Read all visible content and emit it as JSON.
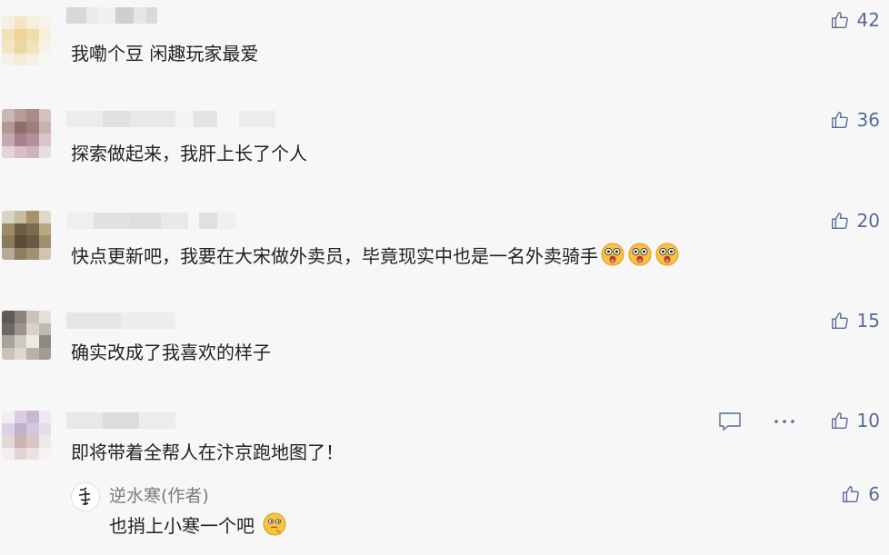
{
  "comments": [
    {
      "text": "我嘞个豆 闲趣玩家最爱",
      "likes": "42"
    },
    {
      "text": "探索做起来，我肝上长了个人",
      "likes": "36"
    },
    {
      "text": "快点更新吧，我要在大宋做外卖员，毕竟现实中也是一名外卖骑手",
      "likes": "20",
      "emoji_names": [
        "surprised-emoji",
        "surprised-emoji",
        "surprised-emoji"
      ]
    },
    {
      "text": "确实改成了我喜欢的样子",
      "likes": "15"
    },
    {
      "text": "即将带着全帮人在汴京跑地图了！",
      "likes": "10"
    }
  ],
  "reply": {
    "author": "逆水寒(作者)",
    "text": "也捎上小寒一个吧",
    "likes": "6",
    "emoji_name": "thinking-emoji"
  },
  "icons": {
    "like": "thumbs-up-icon",
    "reply": "comment-bubble-icon",
    "more": "more-dots-icon"
  },
  "colors": {
    "background": "#f7f7f7",
    "like_text": "#576b95",
    "author_name": "#7a7a7a",
    "body_text": "#222222"
  }
}
